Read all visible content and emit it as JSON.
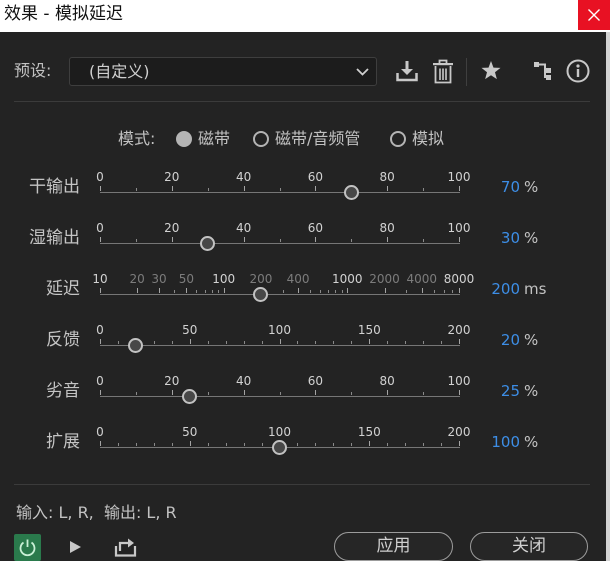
{
  "window": {
    "title": "效果 - 模拟延迟",
    "close_icon": "close-icon"
  },
  "preset": {
    "label": "预设:",
    "selected": "(自定义)",
    "dropdown_icon": "chevron-down-icon"
  },
  "toolbar": {
    "icons": [
      "download-icon",
      "trash-icon",
      "star-icon",
      "routing-icon",
      "info-icon"
    ]
  },
  "mode": {
    "label": "模式:",
    "options": [
      {
        "label": "磁带",
        "selected": true
      },
      {
        "label": "磁带/音频管",
        "selected": false
      },
      {
        "label": "模拟",
        "selected": false
      }
    ]
  },
  "sliders": [
    {
      "label": "干输出",
      "scale": "linear",
      "min": 0,
      "max": 100,
      "minor_step": 10,
      "tick_labels": [
        0,
        20,
        40,
        60,
        80,
        100
      ],
      "value": 70,
      "unit": "%"
    },
    {
      "label": "湿输出",
      "scale": "linear",
      "min": 0,
      "max": 100,
      "minor_step": 10,
      "tick_labels": [
        0,
        20,
        40,
        60,
        80,
        100
      ],
      "value": 30,
      "unit": "%"
    },
    {
      "label": "延迟",
      "scale": "log",
      "min": 10,
      "max": 8000,
      "tick_labels": [
        10,
        20,
        30,
        50,
        100,
        200,
        400,
        1000,
        2000,
        4000,
        8000
      ],
      "emphasized_ticks": [
        10,
        100,
        1000,
        8000
      ],
      "value": 200,
      "unit": "ms"
    },
    {
      "label": "反馈",
      "scale": "linear",
      "min": 0,
      "max": 200,
      "minor_step": 10,
      "tick_labels": [
        0,
        50,
        100,
        150,
        200
      ],
      "value": 20,
      "unit": "%"
    },
    {
      "label": "劣音",
      "scale": "linear",
      "min": 0,
      "max": 100,
      "minor_step": 10,
      "tick_labels": [
        0,
        20,
        40,
        60,
        80,
        100
      ],
      "value": 25,
      "unit": "%"
    },
    {
      "label": "扩展",
      "scale": "linear",
      "min": 0,
      "max": 200,
      "minor_step": 10,
      "tick_labels": [
        0,
        50,
        100,
        150,
        200
      ],
      "value": 100,
      "unit": "%"
    }
  ],
  "io": {
    "text": "输入: L, R,  输出: L, R"
  },
  "footer": {
    "icons": [
      "power-icon",
      "play-icon",
      "export-icon"
    ],
    "apply_label": "应用",
    "close_label": "关闭"
  },
  "colors": {
    "accent": "#3d8ee6",
    "power": "#2a7a4c",
    "close": "#e81123",
    "background": "#232323"
  }
}
